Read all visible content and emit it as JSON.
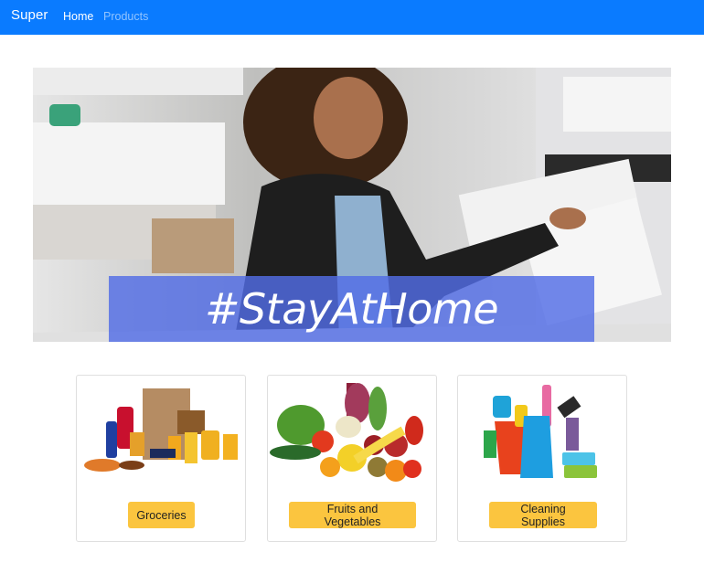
{
  "navbar": {
    "brand": "Super",
    "links": [
      {
        "label": "Home",
        "active": true
      },
      {
        "label": "Products",
        "active": false
      }
    ],
    "color": "#0a7bff"
  },
  "hero": {
    "banner_text": "#StayAtHome",
    "banner_color": "#526de5"
  },
  "categories": [
    {
      "label": "Groceries",
      "icon": "groceries-image"
    },
    {
      "label": "Fruits and Vegetables",
      "icon": "fruits-vegetables-image"
    },
    {
      "label": "Cleaning Supplies",
      "icon": "cleaning-supplies-image"
    }
  ],
  "accent_button_color": "#fbc53f"
}
